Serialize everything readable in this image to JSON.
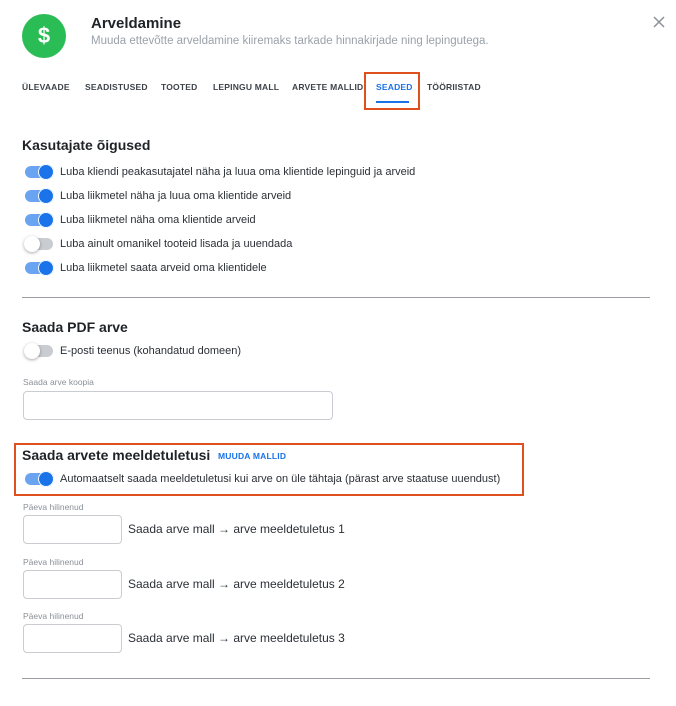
{
  "header": {
    "logo_symbol": "$",
    "title": "Arveldamine",
    "subtitle": "Muuda ettevõtte arveldamine kiiremaks tarkade hinnakirjade ning lepingutega."
  },
  "tabs": [
    {
      "label": "ÜLEVAADE",
      "active": false
    },
    {
      "label": "SEADISTUSED",
      "active": false
    },
    {
      "label": "TOOTED",
      "active": false
    },
    {
      "label": "LEPINGU MALL",
      "active": false
    },
    {
      "label": "ARVETE MALLID",
      "active": false
    },
    {
      "label": "SEADED",
      "active": true
    },
    {
      "label": "TÖÖRIISTAD",
      "active": false
    }
  ],
  "permissions": {
    "title": "Kasutajate õigused",
    "items": [
      {
        "label": "Luba kliendi peakasutajatel näha ja luua oma klientide lepinguid ja arveid",
        "on": true
      },
      {
        "label": "Luba liikmetel näha ja luua oma klientide arveid",
        "on": true
      },
      {
        "label": "Luba liikmetel näha oma klientide arveid",
        "on": true
      },
      {
        "label": "Luba ainult omanikel tooteid lisada ja uuendada",
        "on": false
      },
      {
        "label": "Luba liikmetel saata arveid oma klientidele",
        "on": true
      }
    ]
  },
  "pdf": {
    "title": "Saada PDF arve",
    "email_toggle_label": "E-posti teenus (kohandatud domeen)",
    "email_toggle_on": false,
    "copy_label": "Saada arve koopia",
    "copy_value": ""
  },
  "reminders": {
    "title": "Saada arvete meeldetuletusi",
    "edit_link": "MUUDA MALLID",
    "auto_label": "Automaatselt saada meeldetuletusi kui arve on üle tähtaja (pärast arve staatuse uuendust)",
    "auto_on": true,
    "rows": [
      {
        "field_label": "Päeva hilinenud",
        "value": "",
        "template": "Saada arve mall → arve meeldetuletus 1"
      },
      {
        "field_label": "Päeva hilinenud",
        "value": "",
        "template": "Saada arve mall → arve meeldetuletus 2"
      },
      {
        "field_label": "Päeva hilinenud",
        "value": "",
        "template": "Saada arve mall → arve meeldetuletus 3"
      }
    ]
  },
  "colors": {
    "accent": "#1a73e8",
    "logo_bg": "#2bbd55",
    "highlight": "#e0501f"
  }
}
